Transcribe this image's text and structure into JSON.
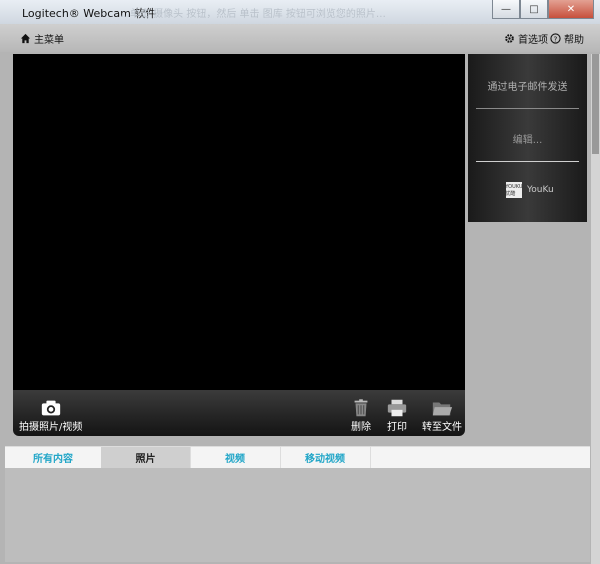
{
  "window": {
    "title": "Logitech® Webcam 软件",
    "ghost_text": "…单击 摄像头 按钮，然后 单击 图库 按钮可浏览您的照片…",
    "controls": {
      "minimize": "—",
      "maximize": "□",
      "close": "✕"
    }
  },
  "menubar": {
    "home_label": "主菜单",
    "settings_label": "首选项",
    "help_label": "帮助"
  },
  "toolbar": {
    "capture_label": "拍摄照片/视频",
    "delete_label": "删除",
    "print_label": "打印",
    "move_label": "转至文件"
  },
  "side_panel": {
    "email_label": "通过电子邮件发送",
    "edit_label": "编辑...",
    "youku_logo": "YOUKU 优酷",
    "youku_label": "YouKu"
  },
  "tabs": [
    {
      "label": "所有内容",
      "active": false
    },
    {
      "label": "照片",
      "active": true
    },
    {
      "label": "视频",
      "active": false
    },
    {
      "label": "移动视频",
      "active": false
    }
  ]
}
